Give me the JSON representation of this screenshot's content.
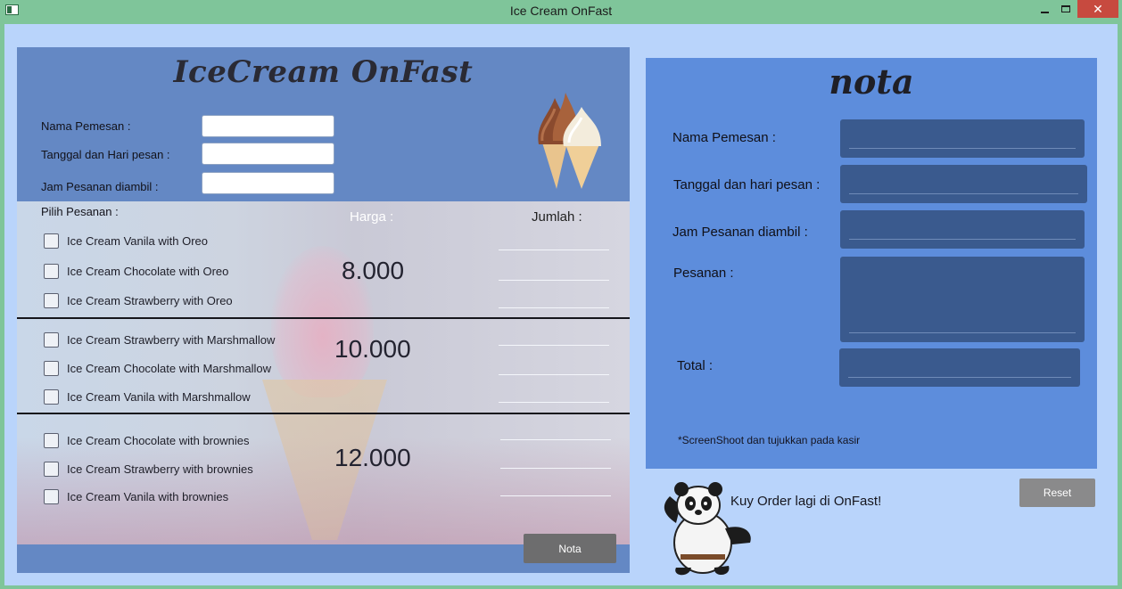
{
  "window": {
    "title": "Ice Cream OnFast",
    "close_glyph": "✕"
  },
  "left": {
    "brand": "IceCream OnFast",
    "fields": [
      {
        "label": "Nama Pemesan :"
      },
      {
        "label": "Tanggal dan Hari pesan :"
      },
      {
        "label": "Jam Pesanan diambil :"
      }
    ],
    "pilih_label": "Pilih Pesanan :",
    "harga_header": "Harga :",
    "jumlah_header": "Jumlah :",
    "groups": [
      {
        "price": "8.000",
        "items": [
          "Ice Cream Vanila with Oreo",
          "Ice Cream Chocolate with Oreo",
          "Ice Cream Strawberry with Oreo"
        ]
      },
      {
        "price": "10.000",
        "items": [
          "Ice Cream Strawberry with Marshmallow",
          "Ice Cream Chocolate with Marshmallow",
          "Ice Cream Vanila with Marshmallow"
        ]
      },
      {
        "price": "12.000",
        "items": [
          "Ice Cream Chocolate with brownies",
          "Ice Cream Strawberry with brownies",
          "Ice Cream Vanila with brownies"
        ]
      }
    ],
    "nota_button": "Nota"
  },
  "right": {
    "title": "nota",
    "labels": {
      "nama": "Nama Pemesan :",
      "tanggal": "Tanggal dan hari pesan :",
      "jam": "Jam Pesanan diambil :",
      "pesanan": "Pesanan :",
      "total": "Total :"
    },
    "note": "*ScreenShoot dan tujukkan pada kasir"
  },
  "footer": {
    "text": "Kuy Order lagi di OnFast!",
    "reset_button": "Reset"
  },
  "colors": {
    "titlebar": "#7fc59a",
    "window_bg": "#b9d4fb",
    "left_panel": "#6488c4",
    "right_panel": "#5d8ddc",
    "field_dark": "#3a5a8e",
    "close": "#c74a3f"
  }
}
